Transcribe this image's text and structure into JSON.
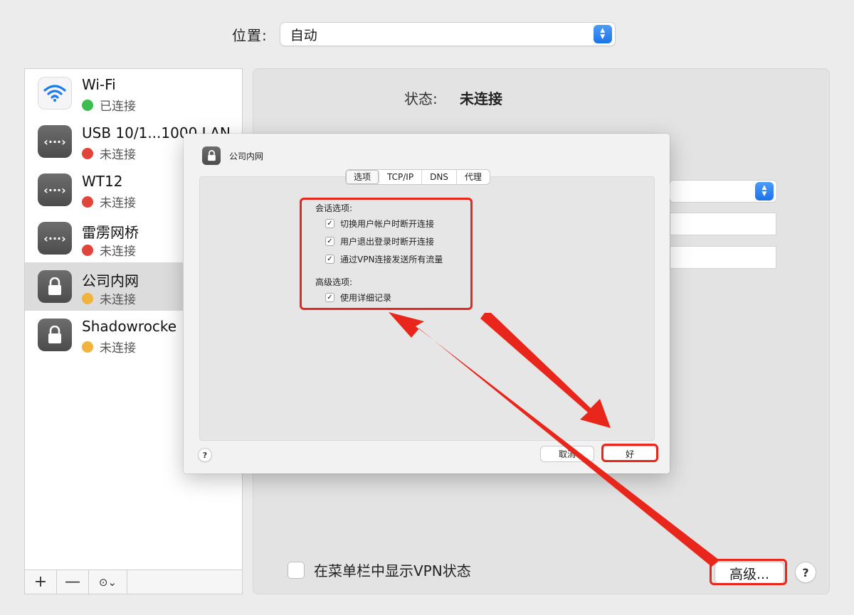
{
  "location": {
    "label": "位置:",
    "value": "自动"
  },
  "services": [
    {
      "name": "Wi-Fi",
      "status": "已连接",
      "icon": "wifi-icon",
      "status_color": "#3dbd4f"
    },
    {
      "name": "USB 10/1...1000 LAN",
      "status": "未连接",
      "icon": "ethernet-icon",
      "status_color": "#e0443a"
    },
    {
      "name": "WT12",
      "status": "未连接",
      "icon": "ethernet-icon",
      "status_color": "#e0443a"
    },
    {
      "name": "雷雳网桥",
      "status": "未连接",
      "icon": "ethernet-icon",
      "status_color": "#e0443a"
    },
    {
      "name": "公司内网",
      "status": "未连接",
      "icon": "lock-icon",
      "status_color": "#f0b43c",
      "selected": true
    },
    {
      "name": "Shadowrocke",
      "status": "未连接",
      "icon": "lock-icon",
      "status_color": "#f0b43c"
    }
  ],
  "toolbar": {
    "add": "+",
    "remove": "—",
    "more": "⊙⌄"
  },
  "panel": {
    "status_label": "状态:",
    "status_value": "未连接",
    "show_vpn_label": "在菜单栏中显示VPN状态",
    "advanced_label": "高级...",
    "help": "?"
  },
  "dialog": {
    "title": "公司内网",
    "tabs": [
      "选项",
      "TCP/IP",
      "DNS",
      "代理"
    ],
    "active_tab": "选项",
    "session_heading": "会话选项:",
    "session_options": [
      {
        "label": "切换用户帐户时断开连接",
        "checked": true
      },
      {
        "label": "用户退出登录时断开连接",
        "checked": true
      },
      {
        "label": "通过VPN连接发送所有流量",
        "checked": true
      }
    ],
    "advanced_heading": "高级选项:",
    "advanced_options": [
      {
        "label": "使用详细记录",
        "checked": true
      }
    ],
    "help": "?",
    "cancel_label": "取消",
    "ok_label": "好"
  },
  "colors": {
    "annotation_red": "#e8261c",
    "accent_blue": "#1a73e8"
  }
}
